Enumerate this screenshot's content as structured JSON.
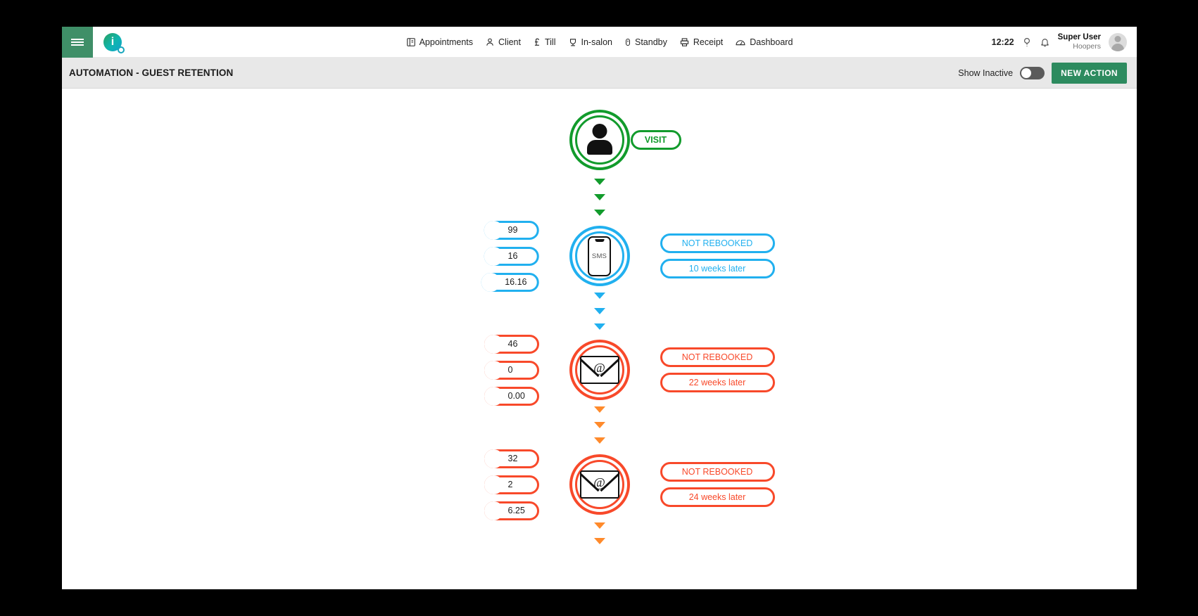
{
  "topnav": {
    "menu_icon": "hamburger-icon",
    "logo_label": "i",
    "items": [
      {
        "label": "Appointments",
        "icon": "book-icon"
      },
      {
        "label": "Client",
        "icon": "person-icon"
      },
      {
        "label": "Till",
        "icon": "pound-icon"
      },
      {
        "label": "In-salon",
        "icon": "chair-icon"
      },
      {
        "label": "Standby",
        "icon": "standby-icon"
      },
      {
        "label": "Receipt",
        "icon": "printer-icon"
      },
      {
        "label": "Dashboard",
        "icon": "gauge-icon"
      }
    ],
    "clock": "12:22",
    "help_icon": "help-icon",
    "bell_icon": "bell-icon",
    "user_name": "Super User",
    "user_org": "Hoopers",
    "avatar": "user-avatar"
  },
  "subheader": {
    "title": "AUTOMATION - GUEST RETENTION",
    "show_inactive_label": "Show Inactive",
    "show_inactive_on": false,
    "new_action_label": "NEW ACTION"
  },
  "colors": {
    "green": "#129b2c",
    "blue": "#21b0ef",
    "red": "#f8492a",
    "orange": "#ff8a2b",
    "brand_green": "#3f8f68",
    "button_green": "#2d8b5f"
  },
  "flow": {
    "start": {
      "icon": "person-icon",
      "label": "VISIT",
      "color": "#129b2c",
      "arrows": 3
    },
    "nodes": [
      {
        "icon": "sms-phone-icon",
        "icon_text": "SMS",
        "color": "#21b0ef",
        "stats": [
          {
            "icon": "arrow-right-icon",
            "value": "99"
          },
          {
            "icon": "refresh-icon",
            "value": "16"
          },
          {
            "icon": "percent-icon",
            "value": "16.16"
          }
        ],
        "labels": [
          "NOT REBOOKED",
          "10 weeks later"
        ],
        "arrows_after": 3,
        "arrows_after_color": "#21b0ef"
      },
      {
        "icon": "email-icon",
        "icon_text": "@",
        "color": "#f8492a",
        "stats": [
          {
            "icon": "arrow-right-icon",
            "value": "46"
          },
          {
            "icon": "refresh-icon",
            "value": "0"
          },
          {
            "icon": "percent-icon",
            "value": "0.00"
          }
        ],
        "labels": [
          "NOT REBOOKED",
          "22 weeks later"
        ],
        "arrows_after": 3,
        "arrows_after_color": "#ff8a2b"
      },
      {
        "icon": "email-icon",
        "icon_text": "@",
        "color": "#f8492a",
        "stats": [
          {
            "icon": "arrow-right-icon",
            "value": "32"
          },
          {
            "icon": "refresh-icon",
            "value": "2"
          },
          {
            "icon": "percent-icon",
            "value": "6.25"
          }
        ],
        "labels": [
          "NOT REBOOKED",
          "24 weeks later"
        ],
        "arrows_after": 2,
        "arrows_after_color": "#ff8a2b"
      }
    ]
  }
}
